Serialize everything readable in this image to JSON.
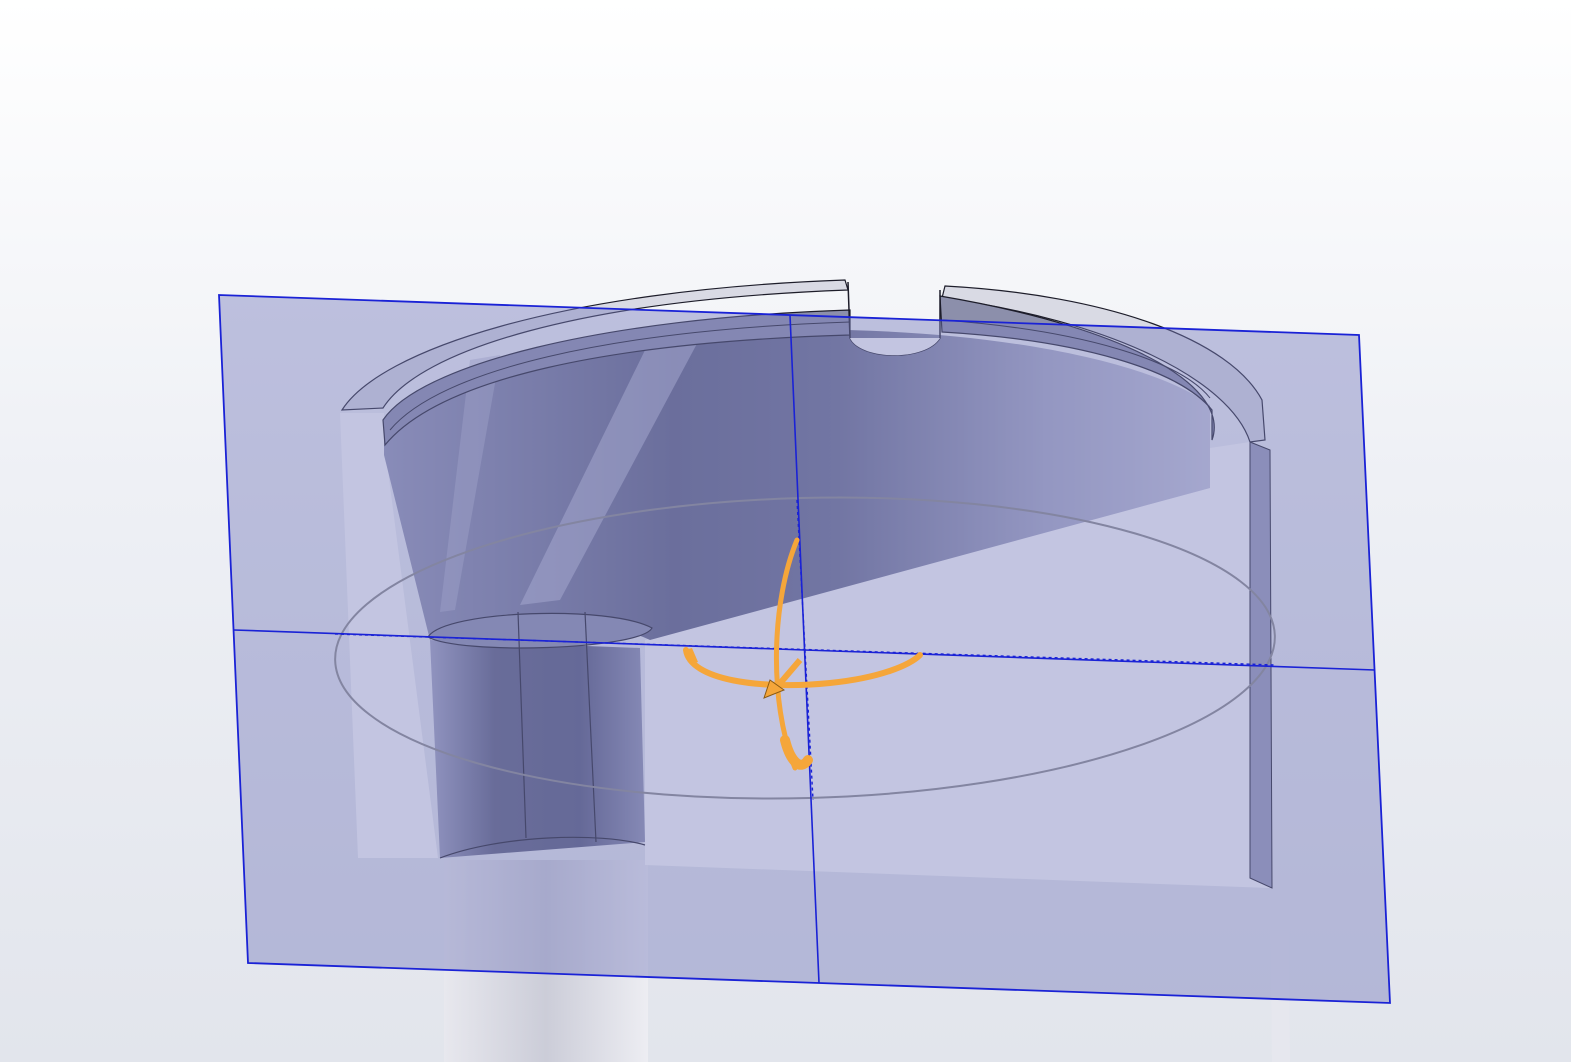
{
  "viewport": {
    "kind": "3D CAD section view",
    "background": [
      "#ffffff",
      "#e2e5ec"
    ],
    "colors": {
      "plane_fill": "#7b7fbd",
      "plane_edge": "#1a22d6",
      "model_dark": "#5c5f7e",
      "model_mid": "#8e91b0",
      "cut_face": "#ffffff",
      "edge_line": "#1d1d2a",
      "sketch_circle": "#8a8a8a",
      "triad": "#f5a63a"
    },
    "icons": {
      "section_plane": "plane-icon",
      "rotate_triad": "rotate-triad-icon",
      "direction_arrow": "arrow-icon"
    }
  }
}
